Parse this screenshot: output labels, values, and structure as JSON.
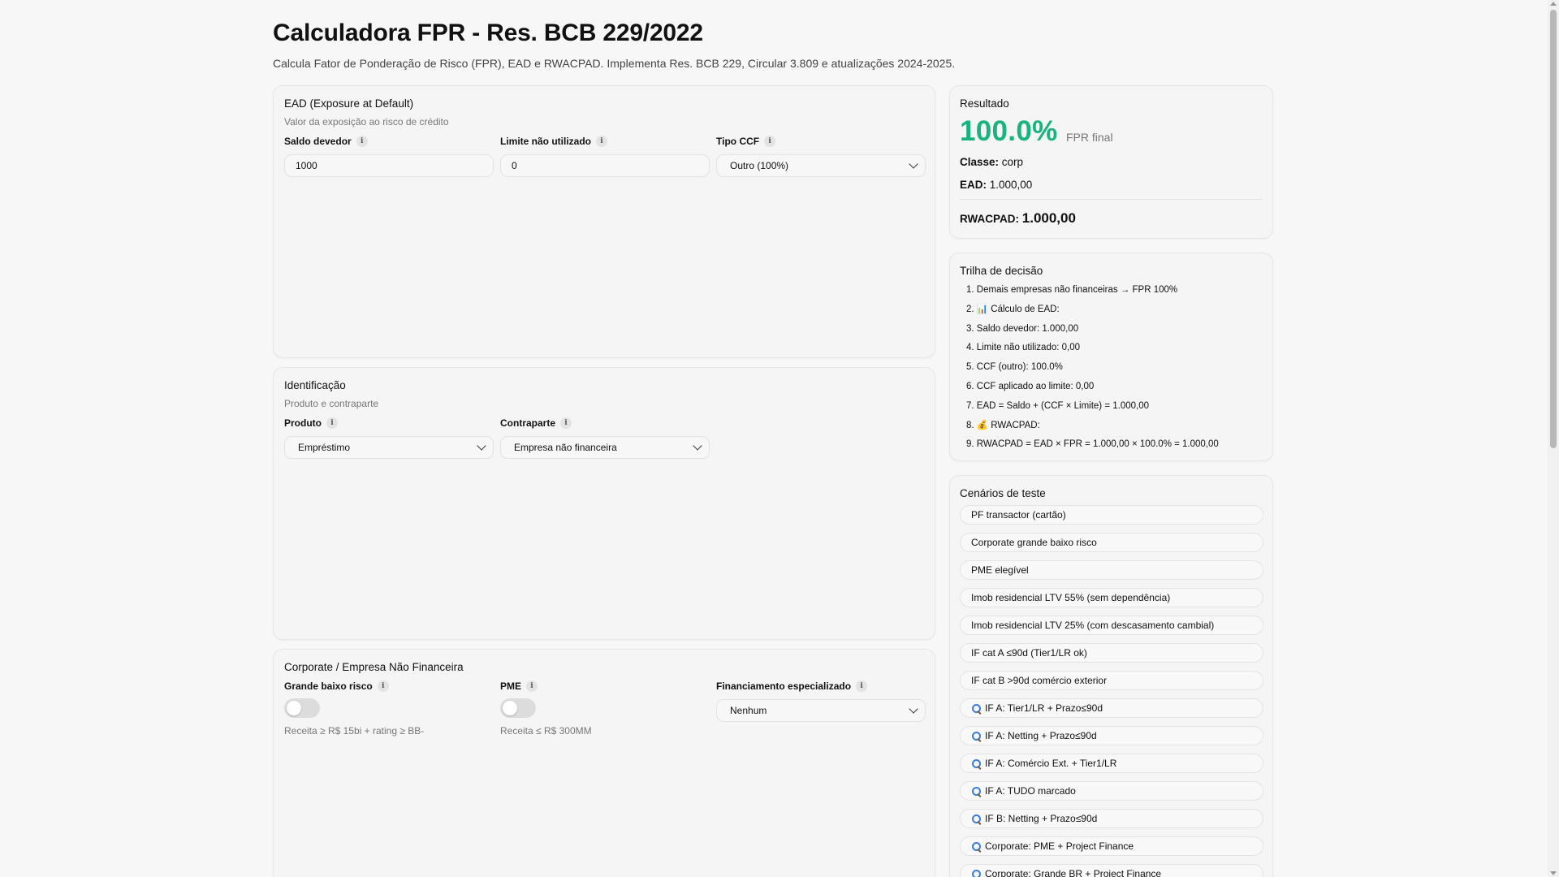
{
  "header": {
    "title": "Calculadora FPR - Res. BCB 229/2022",
    "subtitle": "Calcula Fator de Ponderação de Risco (FPR), EAD e RWACPAD. Implementa Res. BCB 229, Circular 3.809 e atualizações 2024-2025."
  },
  "ead": {
    "title": "EAD (Exposure at Default)",
    "desc": "Valor da exposição ao risco de crédito",
    "saldo_label": "Saldo devedor",
    "saldo_value": "1000",
    "limite_label": "Limite não utilizado",
    "limite_value": "0",
    "ccf_label": "Tipo CCF",
    "ccf_value": "Outro (100%)"
  },
  "ident": {
    "title": "Identificação",
    "desc": "Produto e contraparte",
    "produto_label": "Produto",
    "produto_value": "Empréstimo",
    "contraparte_label": "Contraparte",
    "contraparte_value": "Empresa não financeira"
  },
  "corp": {
    "title": "Corporate / Empresa Não Financeira",
    "grande_label": "Grande baixo risco",
    "grande_on": false,
    "grande_hint": "Receita ≥ R$ 15bi + rating ≥ BB-",
    "pme_label": "PME",
    "pme_on": false,
    "pme_hint": "Receita ≤ R$ 300MM",
    "fin_label": "Financiamento especializado",
    "fin_value": "Nenhum"
  },
  "result": {
    "title": "Resultado",
    "fpr": "100.0%",
    "fpr_label": "FPR final",
    "classe_label": "Classe:",
    "classe_value": "corp",
    "ead_label": "EAD:",
    "ead_value": "1.000,00",
    "rwa_label": "RWACPAD:",
    "rwa_value": "1.000,00"
  },
  "trail": {
    "title": "Trilha de decisão",
    "items": [
      "1. Demais empresas não financeiras → FPR 100%",
      "2. 📊 Cálculo de EAD:",
      "3. Saldo devedor: 1.000,00",
      "4. Limite não utilizado: 0,00",
      "5. CCF (outro): 100.0%",
      "6. CCF aplicado ao limite: 0,00",
      "7. EAD = Saldo + (CCF × Limite) = 1.000,00",
      "8. 💰 RWACPAD:",
      "9. RWACPAD = EAD × FPR = 1.000,00 × 100.0% = 1.000,00"
    ]
  },
  "scenarios": {
    "title": "Cenários de teste",
    "items": [
      {
        "label": "PF transactor (cartão)",
        "icon": ""
      },
      {
        "label": "Corporate grande baixo risco",
        "icon": ""
      },
      {
        "label": "PME elegível",
        "icon": ""
      },
      {
        "label": "Imob residencial LTV 55% (sem dependência)",
        "icon": ""
      },
      {
        "label": "Imob residencial LTV 25% (com descasamento cambial)",
        "icon": ""
      },
      {
        "label": "IF cat A ≤90d (Tier1/LR ok)",
        "icon": ""
      },
      {
        "label": "IF cat B >90d comércio exterior",
        "icon": ""
      },
      {
        "label": "IF A: Tier1/LR + Prazo≤90d",
        "icon": "magnifier-icon"
      },
      {
        "label": "IF A: Netting + Prazo≤90d",
        "icon": "magnifier-icon"
      },
      {
        "label": "IF A: Comércio Ext. + Tier1/LR",
        "icon": "magnifier-icon"
      },
      {
        "label": "IF A: TUDO marcado",
        "icon": "magnifier-icon"
      },
      {
        "label": "IF B: Netting + Prazo≤90d",
        "icon": "magnifier-icon"
      },
      {
        "label": "Corporate: PME + Project Finance",
        "icon": "magnifier-icon"
      },
      {
        "label": "Corporate: Grande BR + Project Finance",
        "icon": "magnifier-icon"
      }
    ]
  },
  "colors": {
    "accent_green": "#19b37e",
    "background": "#f7f7f7"
  }
}
